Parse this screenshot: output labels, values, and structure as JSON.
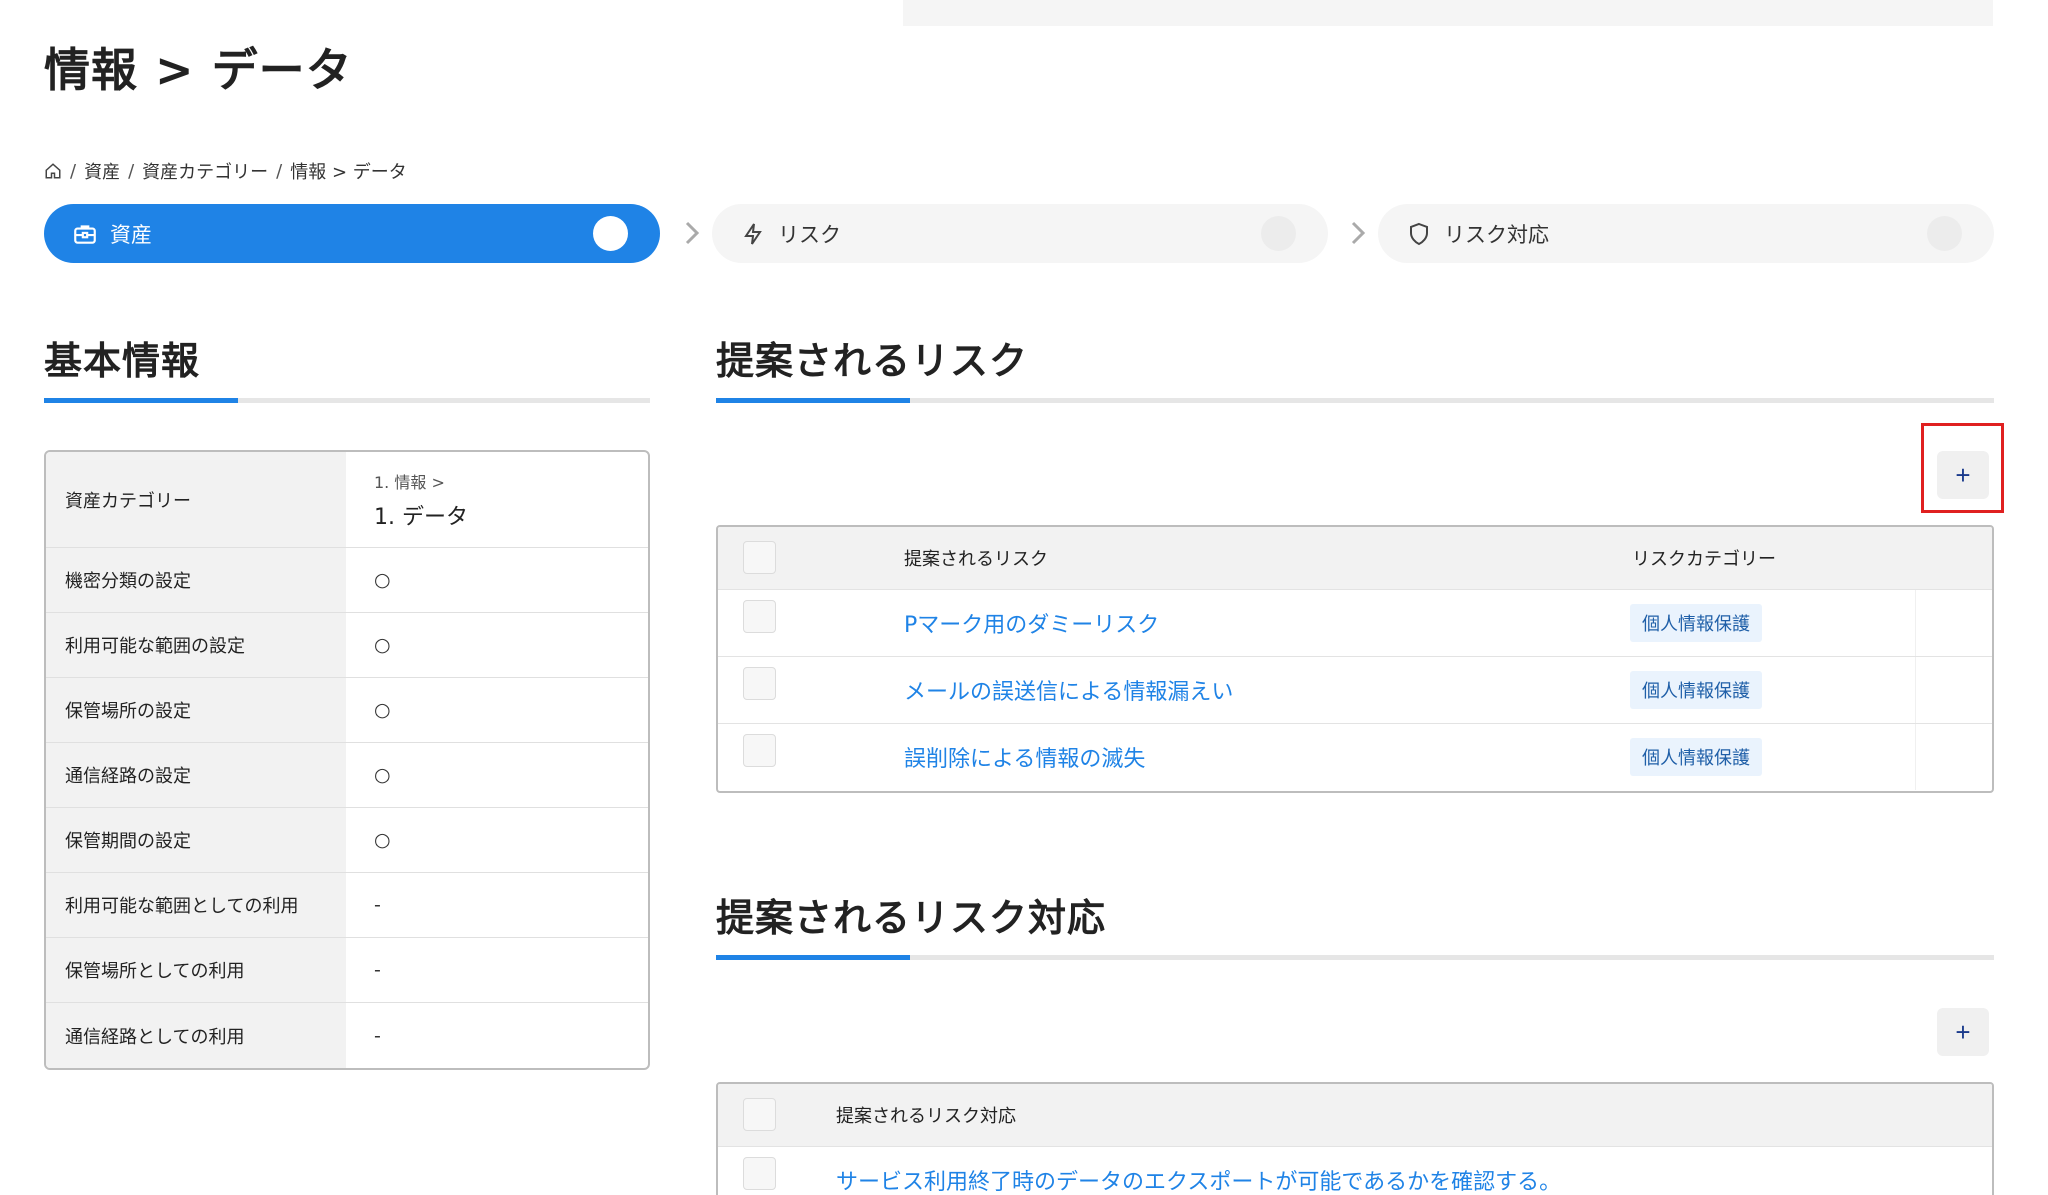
{
  "page": {
    "title": "情報 > データ"
  },
  "breadcrumb": {
    "items": [
      "資産",
      "資産カテゴリー",
      "情報 > データ"
    ]
  },
  "stepper": [
    {
      "label": "資産",
      "icon": "briefcase-icon",
      "active": true
    },
    {
      "label": "リスク",
      "icon": "lightning-icon",
      "active": false
    },
    {
      "label": "リスク対応",
      "icon": "shield-icon",
      "active": false
    }
  ],
  "basic_info": {
    "title": "基本情報",
    "rows": [
      {
        "label": "資産カテゴリー",
        "sub": "1. 情報 >",
        "value": "1. データ"
      },
      {
        "label": "機密分類の設定",
        "value": "○"
      },
      {
        "label": "利用可能な範囲の設定",
        "value": "○"
      },
      {
        "label": "保管場所の設定",
        "value": "○"
      },
      {
        "label": "通信経路の設定",
        "value": "○"
      },
      {
        "label": "保管期間の設定",
        "value": "○"
      },
      {
        "label": "利用可能な範囲としての利用",
        "value": "-"
      },
      {
        "label": "保管場所としての利用",
        "value": "-"
      },
      {
        "label": "通信経路としての利用",
        "value": "-"
      }
    ]
  },
  "risks": {
    "title": "提案されるリスク",
    "add_label": "+",
    "columns": [
      "提案されるリスク",
      "リスクカテゴリー"
    ],
    "rows": [
      {
        "name": "Pマーク用のダミーリスク",
        "category": "個人情報保護"
      },
      {
        "name": "メールの誤送信による情報漏えい",
        "category": "個人情報保護"
      },
      {
        "name": "誤削除による情報の滅失",
        "category": "個人情報保護"
      }
    ]
  },
  "risk_responses": {
    "title": "提案されるリスク対応",
    "add_label": "+",
    "columns": [
      "提案されるリスク対応"
    ],
    "rows": [
      {
        "name": "サービス利用終了時のデータのエクスポートが可能であるかを確認する。"
      }
    ]
  },
  "colors": {
    "accent": "#1f83e6",
    "highlight": "#e02020",
    "tag_bg": "#eaf3fd"
  }
}
